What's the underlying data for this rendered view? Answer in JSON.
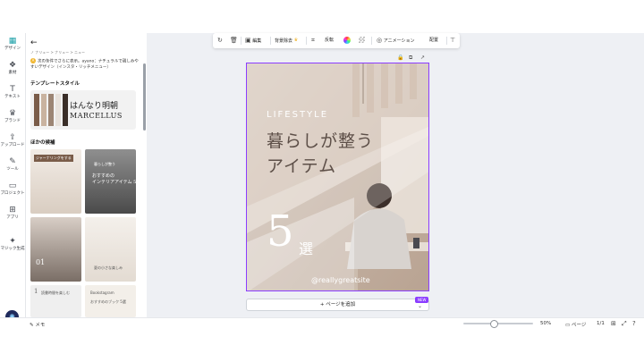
{
  "rail": {
    "items": [
      {
        "label": "デザイン",
        "icon": "layout-icon"
      },
      {
        "label": "素材",
        "icon": "elements-icon"
      },
      {
        "label": "テキスト",
        "icon": "text-icon"
      },
      {
        "label": "ブランド",
        "icon": "brand-icon"
      },
      {
        "label": "アップロード",
        "icon": "upload-icon"
      },
      {
        "label": "ツール",
        "icon": "pen-icon"
      },
      {
        "label": "プロジェクト",
        "icon": "folder-icon"
      },
      {
        "label": "アプリ",
        "icon": "apps-icon"
      },
      {
        "label": "マジック生成",
        "icon": "magic-icon"
      }
    ]
  },
  "panel": {
    "breadcrumb": "ノ ナリュー > ナリュー > ニュー",
    "notice": "次の条件でさらに表示。ayano：ナチュラルで親しみやすいデザイン（インスタ・リッチメニュー）",
    "template_style_title": "テンプレートスタイル",
    "style_font_jp": "はんなり明朝",
    "style_font_en": "MARCELLUS",
    "others_title": "ほかの候補",
    "thumbs": [
      {
        "caption": "ジャーナリングをする",
        "big": ""
      },
      {
        "caption": "暮らしが整う",
        "big": "おすすめの\nインテリアアイテム 5選"
      },
      {
        "caption": "01",
        "big": "01"
      },
      {
        "caption": "夏の小さな楽しみ",
        "big": ""
      },
      {
        "caption": "読書時間を楽しむ",
        "big": "1"
      },
      {
        "caption": "Bookstagram",
        "big": "おすすめのブック 5選"
      }
    ],
    "swatch_colors": [
      "#7a5c49",
      "#c9b3a0",
      "#9c8574",
      "#f2f2f2",
      "#3a2e28"
    ]
  },
  "toolbar": {
    "edit": "編集",
    "bg_remove": "背景除去",
    "flip": "反転",
    "animation": "アニメーション",
    "arrange": "配置"
  },
  "design": {
    "kicker": "LIFESTYLE",
    "title_line1": "暮らしが整う",
    "title_line2": "アイテム",
    "number": "5",
    "unit": "選",
    "handle": "@reallygreatsite"
  },
  "canvas": {
    "add_page": "+ ページを追加",
    "new_badge": "NEW"
  },
  "bottom": {
    "memo": "メモ",
    "zoom": "50%",
    "zoom_fraction": 0.5,
    "pages": "ページ",
    "page_count": "1/1"
  }
}
